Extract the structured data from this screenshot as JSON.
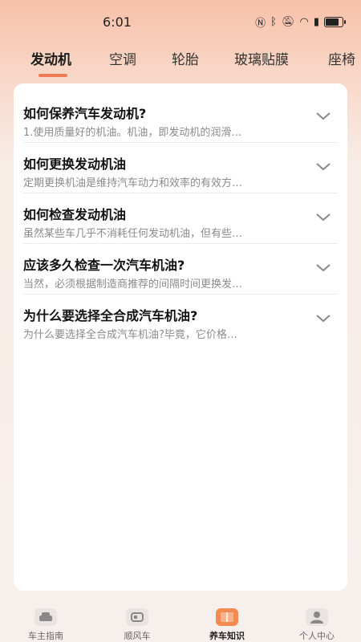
{
  "status_bar": {
    "time": "6:01",
    "battery_level": 0.9
  },
  "tabs": [
    {
      "label": "发动机",
      "active": true
    },
    {
      "label": "空调",
      "active": false
    },
    {
      "label": "轮胎",
      "active": false
    },
    {
      "label": "玻璃贴膜",
      "active": false
    },
    {
      "label": "座椅",
      "active": false
    }
  ],
  "faq": [
    {
      "question": "如何保养汽车发动机?",
      "answer": "1.使用质量好的机油。机油，即发动机的润滑…"
    },
    {
      "question": "如何更换发动机油",
      "answer": "定期更换机油是维持汽车动力和效率的有效方…"
    },
    {
      "question": "如何检查发动机油",
      "answer": "虽然某些车几乎不消耗任何发动机油，但有些…"
    },
    {
      "question": "应该多久检查一次汽车机油?",
      "answer": "当然，必须根据制造商推荐的间隔时间更换发…"
    },
    {
      "question": "为什么要选择全合成汽车机油?",
      "answer": "为什么要选择全合成汽车机油?毕竟，它价格…"
    }
  ],
  "bottom_nav": [
    {
      "label": "车主指南",
      "icon": "car-icon",
      "active": false
    },
    {
      "label": "顺风车",
      "icon": "rideshare-icon",
      "active": false
    },
    {
      "label": "养车知识",
      "icon": "book-icon",
      "active": true
    },
    {
      "label": "个人中心",
      "icon": "person-icon",
      "active": false
    }
  ],
  "colors": {
    "accent": "#f07a55",
    "active_icon": "#f58a4f"
  }
}
